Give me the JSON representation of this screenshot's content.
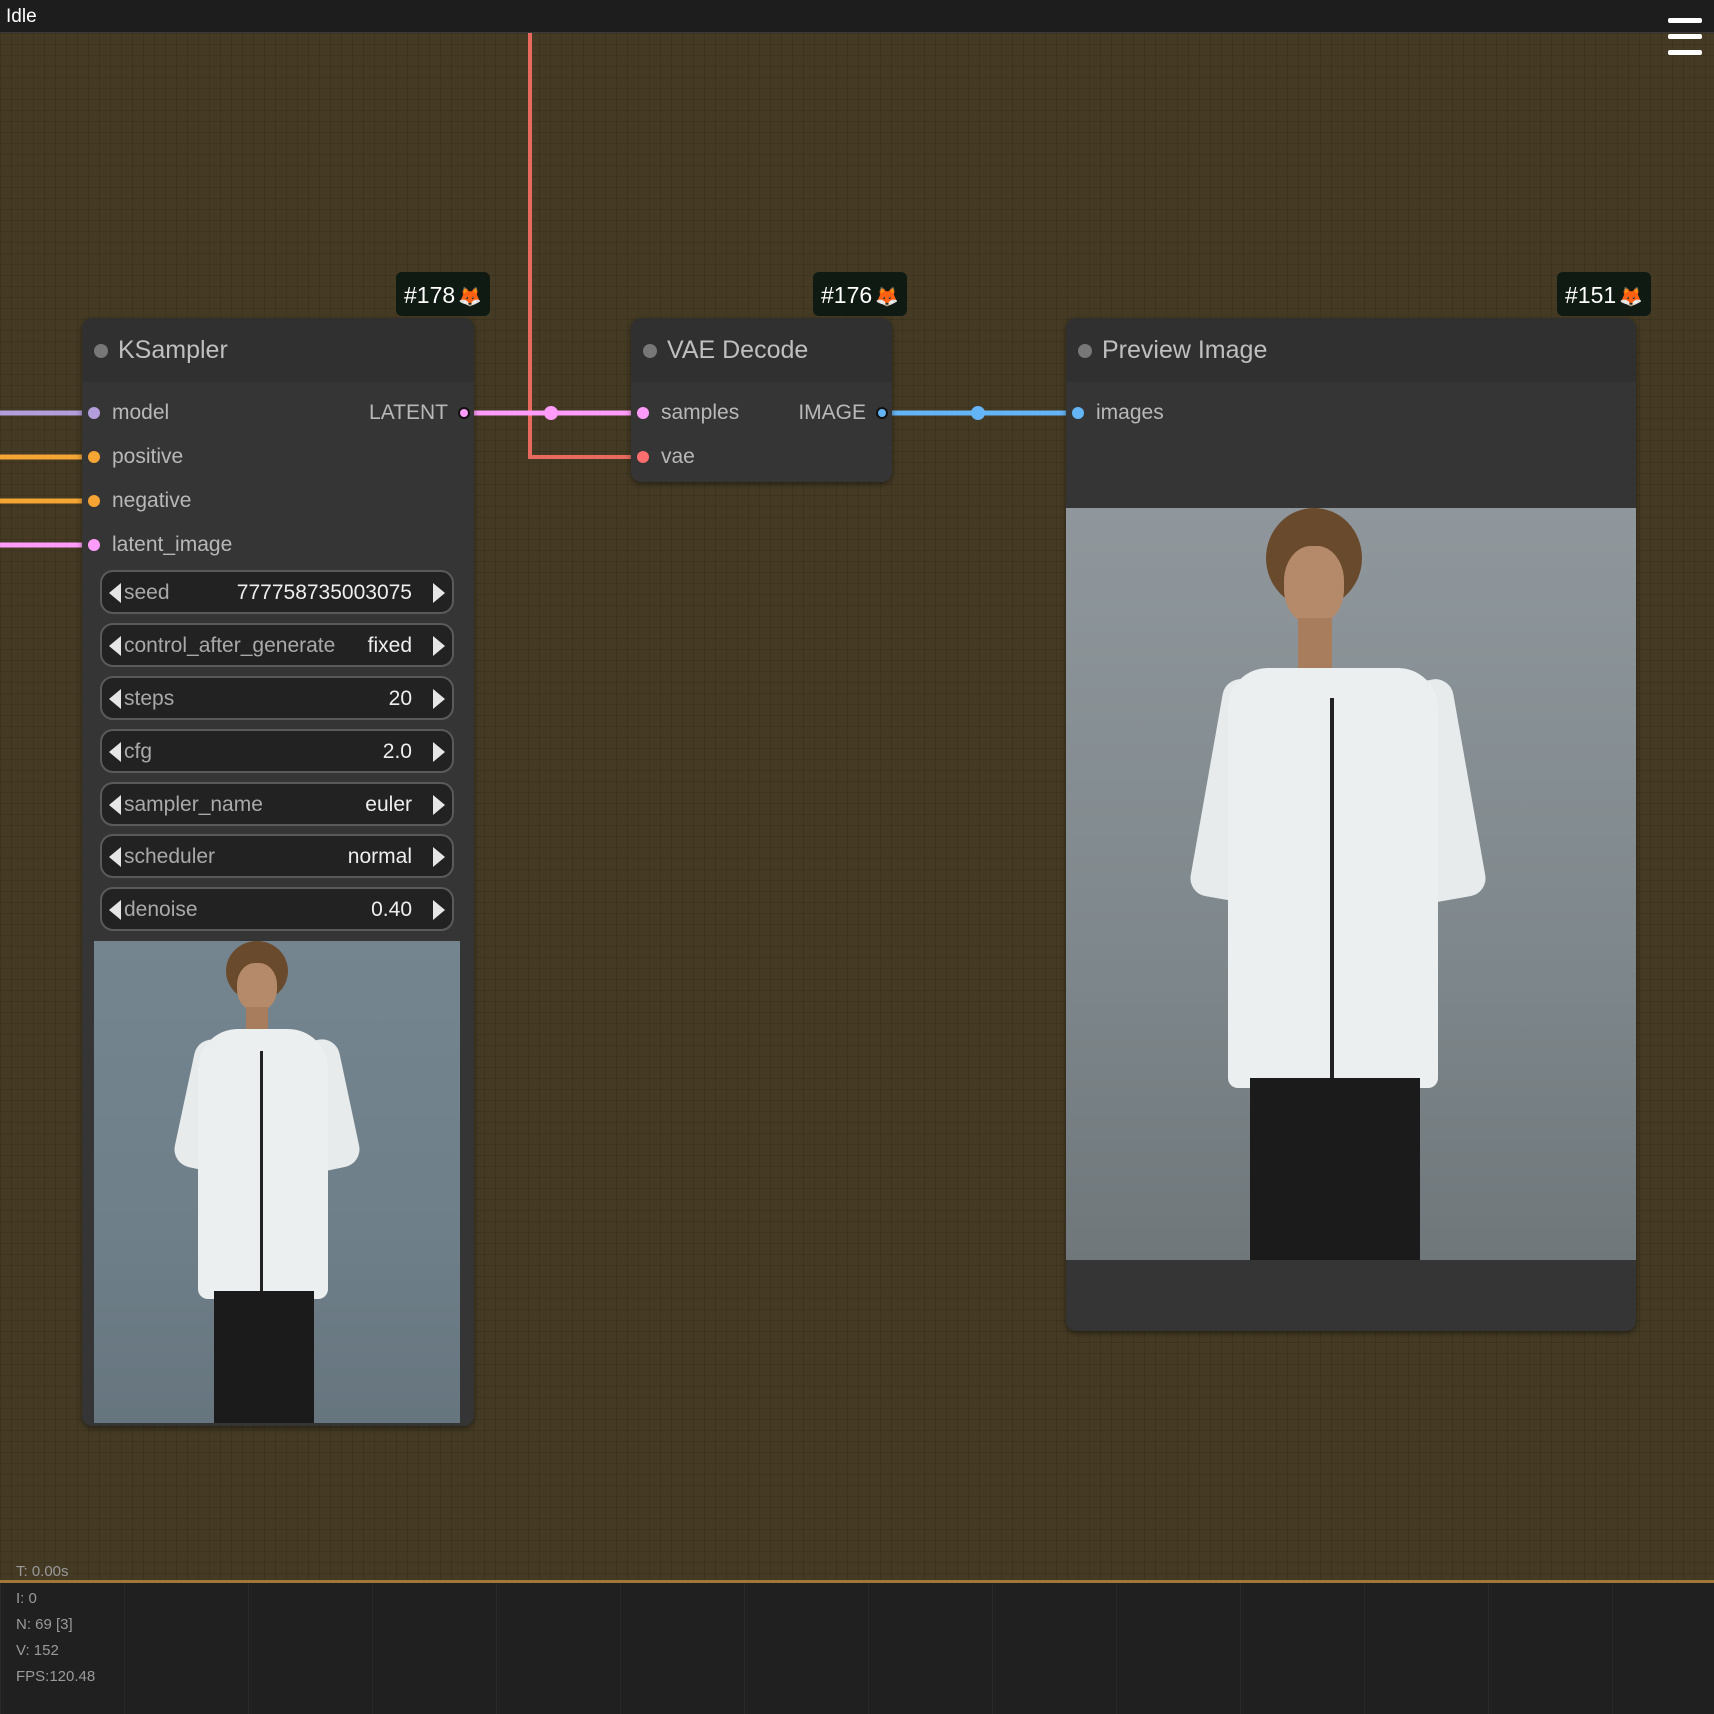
{
  "topbar": {
    "status": "Idle"
  },
  "nodes": {
    "ksampler": {
      "id_badge": "#178",
      "title": "KSampler",
      "inputs": [
        "model",
        "positive",
        "negative",
        "latent_image"
      ],
      "output": "LATENT",
      "widgets": [
        {
          "label": "seed",
          "value": "777758735003075"
        },
        {
          "label": "control_after_generate",
          "value": "fixed"
        },
        {
          "label": "steps",
          "value": "20"
        },
        {
          "label": "cfg",
          "value": "2.0"
        },
        {
          "label": "sampler_name",
          "value": "euler"
        },
        {
          "label": "scheduler",
          "value": "normal"
        },
        {
          "label": "denoise",
          "value": "0.40"
        }
      ]
    },
    "vae_decode": {
      "id_badge": "#176",
      "title": "VAE Decode",
      "inputs": [
        "samples",
        "vae"
      ],
      "output": "IMAGE"
    },
    "preview_image": {
      "id_badge": "#151",
      "title": "Preview Image",
      "inputs": [
        "images"
      ]
    }
  },
  "colors": {
    "canvas": "#453b24",
    "model": "#b39ddb",
    "conditioning": "#f4a533",
    "latent": "#ff9cf9",
    "vae": "#ff6e6e",
    "image": "#64b5f6"
  },
  "stats": {
    "t": "T: 0.00s",
    "i": "I: 0",
    "n": "N: 69 [3]",
    "v": "V: 152",
    "fps": "FPS:120.48"
  }
}
